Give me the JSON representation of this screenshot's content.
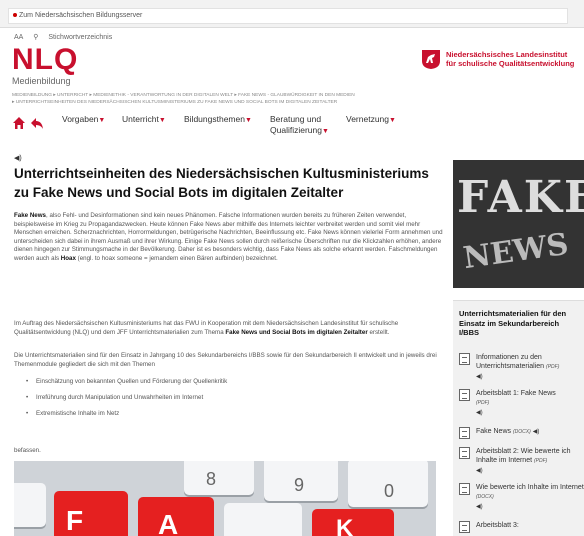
{
  "topbar": {
    "label": "Zum Niedersächsischen Bildungsserver"
  },
  "search": {
    "aa": "AA",
    "label": "Stichwortverzeichnis"
  },
  "logo": {
    "name": "NLQ",
    "subtitle": "Medienbildung"
  },
  "institute": {
    "line1": "Niedersächsisches Landesinstitut",
    "line2": "für schulische Qualitätsentwicklung"
  },
  "breadcrumb": {
    "line1": "MEDIENBILDUNG   ▸ UNTERRICHT   ▸ MEDIENETHIK - VERANTWORTUNG IN DER DIGITALEN WELT   ▸ FAKE NEWS - GLAUBWÜRDIGKEIT IN DEN MEDIEN",
    "line2": "▸ UNTERRICHTSEINHEITEN DES NIEDERSÄCHSISCHEN KULTUSMINISTERIUMS ZU FAKE NEWS UND SOCIAL BOTS IM DIGITALEN ZEITALTER"
  },
  "nav": {
    "caret": "▼",
    "items": [
      {
        "label": "Vorgaben"
      },
      {
        "label": "Unterricht"
      },
      {
        "label": "Bildungsthemen"
      },
      {
        "label": "Beratung und",
        "label2": "Qualifizierung"
      },
      {
        "label": "Vernetzung"
      }
    ]
  },
  "speaker": "◀)",
  "article": {
    "title": "Unterrichtseinheiten des Niedersächsischen Kultusministeriums zu Fake News und Social Bots im digitalen Zeitalter",
    "p1_bold": "Fake News",
    "p1_rest": ", also Fehl- und Desinformationen sind kein neues Phänomen. Falsche Informationen wurden bereits zu früheren Zeiten verwendet, beispielsweise im Krieg zu Propagandazwecken. Heute können Fake News aber mithilfe des Internets leichter verbreitet werden und somit viel mehr Menschen erreichen. Scherznachrichten, Horrormeldungen, betrügerische Nachrichten, Beeinflussung etc. Fake News können vielerlei Form annehmen und unterscheiden sich dabei in ihrem Ausmaß und ihrer Wirkung. Einige Fake News sollen durch reißerische Überschriften nur die Klickzahlen erhöhen, andere dienen hingegen zur Stimmungsmache in der Bevölkerung. Daher ist es besonders wichtig, dass Fake News als solche erkannt werden. Falschmeldungen werden auch als ",
    "p1_hoax": "Hoax",
    "p1_end": " (engl. to hoax someone = jemandem einen Bären aufbinden) bezeichnet.",
    "p2_start": "Im Auftrag des  Niedersächsischen Kultusministeriums hat das FWU in Kooperation mit dem Niedersächsischen Landesinstitut für schulische Qualitätsentwicklung (NLQ) und dem JFF Unterrichtsmaterialien zum Thema ",
    "p2_bold": "Fake News und Social Bots im digitalen Zeitalter",
    "p2_end": " erstellt.",
    "p3": "Die Unterrichtsmaterialien sind für den Einsatz in Jahrgang 10 des Sekundarbereichs I/BBS sowie für den Sekundarbereich II entwickelt und in jeweils drei Themenmodule gegliedert die sich mit den Themen",
    "bullets": [
      "Einschätzung von bekannten Quellen und Förderung der Quellenkritik",
      "Irreführung durch Manipulation und Unwahrheiten im Internet",
      "Extremistische Inhalte im Netz"
    ],
    "befassen": "befassen."
  },
  "keyboard": {
    "keys": [
      "8",
      "9",
      "0",
      "F",
      "A",
      "K"
    ]
  },
  "sidebar": {
    "image_word1": "FAKE",
    "image_word2": "NEWS",
    "heading": "Unterrichtsmaterialien für den Einsatz im Sekundarbereich I/BBS",
    "resources": [
      {
        "label": "Informationen zu den Unterrichtsmaterialien",
        "format": "(PDF)"
      },
      {
        "label": "Arbeitsblatt 1: Fake News",
        "format": "(PDF)"
      },
      {
        "label": "Fake News",
        "format": "(DOCX)"
      },
      {
        "label": "Arbeitsblatt 2: Wie bewerte ich Inhalte im Internet",
        "format": "(PDF)"
      },
      {
        "label": "Wie bewerte ich Inhalte im Internet",
        "format": "(DOCX)"
      },
      {
        "label": "Arbeitsblatt 3:",
        "format": ""
      }
    ]
  },
  "colors": {
    "brand_red": "#c8102e"
  }
}
